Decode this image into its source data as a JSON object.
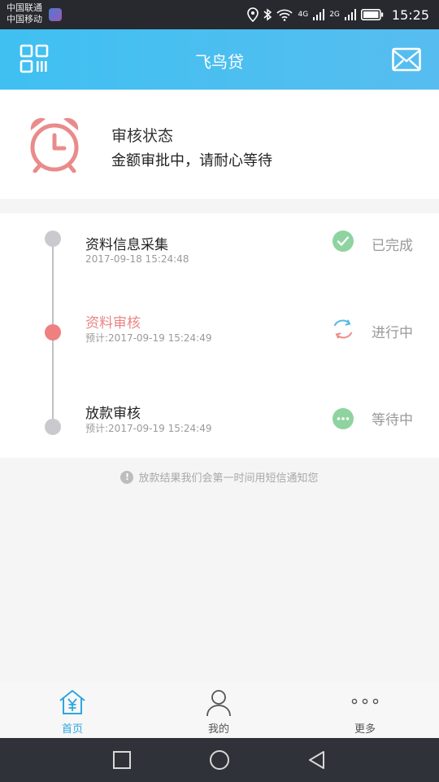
{
  "status_bar": {
    "carrier1": "中国联通",
    "carrier2": "中国移动",
    "net1": "4G",
    "net2": "2G",
    "time": "15:25"
  },
  "header": {
    "title": "飞鸟贷"
  },
  "review": {
    "title": "审核状态",
    "desc": "金额审批中，请耐心等待"
  },
  "steps": [
    {
      "title": "资料信息采集",
      "time": "2017-09-18 15:24:48",
      "status": "已完成",
      "icon": "check-circle-icon"
    },
    {
      "title": "资料审核",
      "time": "预计:2017-09-19 15:24:49",
      "status": "进行中",
      "icon": "refresh-icon"
    },
    {
      "title": "放款审核",
      "time": "预计:2017-09-19 15:24:49",
      "status": "等待中",
      "icon": "more-circle-icon"
    }
  ],
  "notice": "放款结果我们会第一时间用短信通知您",
  "nav": {
    "home": "首页",
    "mine": "我的",
    "more": "更多"
  },
  "colors": {
    "header": "#3fc0f1",
    "active_step": "#e98585",
    "done": "#8ed3a0",
    "nav_active": "#2ca6df"
  }
}
